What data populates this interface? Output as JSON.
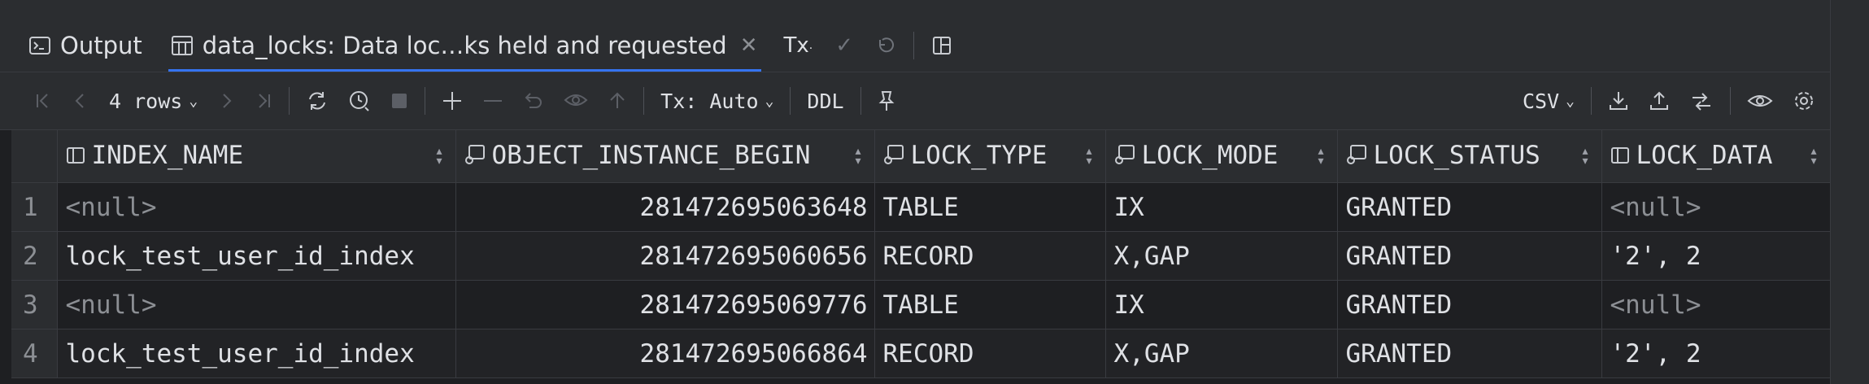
{
  "tabs": [
    {
      "label": "Output",
      "icon": "terminal-icon",
      "active": false
    },
    {
      "label": "data_locks: Data loc…ks held and requested",
      "icon": "table-icon",
      "active": true
    }
  ],
  "tab_tools": {
    "tx_label": "Tx"
  },
  "toolbar": {
    "rows_label": "4 rows",
    "tx_mode": "Tx: Auto",
    "ddl_label": "DDL",
    "export_format": "CSV"
  },
  "columns": [
    {
      "name": "INDEX_NAME",
      "icon": "column-icon"
    },
    {
      "name": "OBJECT_INSTANCE_BEGIN",
      "icon": "key-column-icon"
    },
    {
      "name": "LOCK_TYPE",
      "icon": "key-column-icon"
    },
    {
      "name": "LOCK_MODE",
      "icon": "key-column-icon"
    },
    {
      "name": "LOCK_STATUS",
      "icon": "key-column-icon"
    },
    {
      "name": "LOCK_DATA",
      "icon": "column-icon"
    }
  ],
  "rows": [
    {
      "num": "1",
      "cells": [
        "<null>",
        "281472695063648",
        "TABLE",
        "IX",
        "GRANTED",
        "<null>"
      ]
    },
    {
      "num": "2",
      "cells": [
        "lock_test_user_id_index",
        "281472695060656",
        "RECORD",
        "X,GAP",
        "GRANTED",
        "'2', 2"
      ]
    },
    {
      "num": "3",
      "cells": [
        "<null>",
        "281472695069776",
        "TABLE",
        "IX",
        "GRANTED",
        "<null>"
      ]
    },
    {
      "num": "4",
      "cells": [
        "lock_test_user_id_index",
        "281472695066864",
        "RECORD",
        "X,GAP",
        "GRANTED",
        "'2', 2"
      ]
    }
  ],
  "colors": {
    "background": "#1e1f22",
    "panel": "#2b2d30",
    "accent": "#3574f0",
    "null_text": "#8c8f94"
  }
}
